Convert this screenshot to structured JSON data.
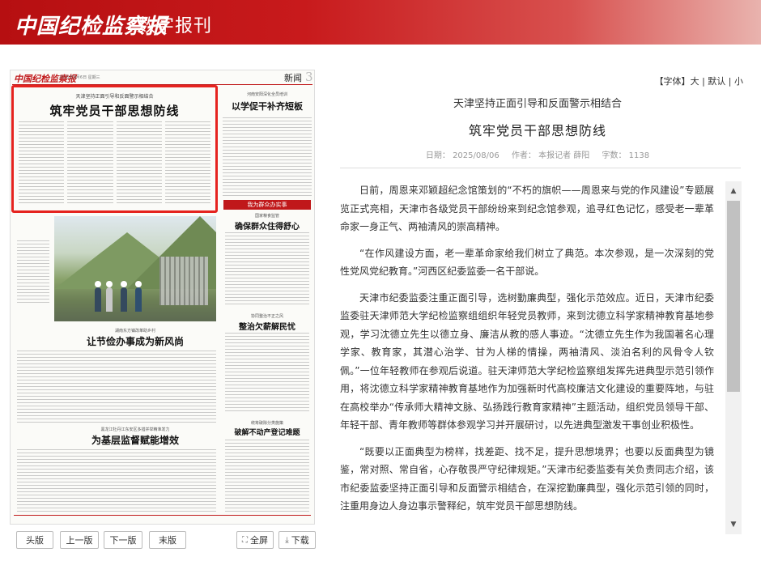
{
  "header": {
    "logo": "中国纪检监察报",
    "subtitle": "数字报刊"
  },
  "paper": {
    "masthead": "中国纪检监察报",
    "date_line": "2025年8月6日 星期三",
    "section": "新闻",
    "page_number": "3",
    "highlight_kicker": "天津坚持正面引导和反面警示相结合",
    "highlight_title": "筑牢党员干部思想防线",
    "right_kicker": "河南安阳深化全员培训",
    "right_title": "以学促干补齐短板",
    "red_bar": "我为群众办实事",
    "sec1_kicker": "国家粮食监管",
    "sec1_title": "确保群众住得舒心",
    "sec2_kicker": "湖南东方镇改革助乡村",
    "sec2_title": "让节俭办事成为新风尚",
    "sec3_kicker": "协同整治不正之风",
    "sec3_title": "整治欠薪解民忧",
    "sec4_kicker": "黑龙江牡丹江东安区多措并举精准发力",
    "sec4_title": "为基层监督赋能增效",
    "sec5_kicker": "统筹破除分类施策",
    "sec5_title": "破解不动产登记难题"
  },
  "font_size": {
    "label": "【字体】",
    "large": "大",
    "default": "默认",
    "small": "小",
    "sep": "|"
  },
  "article": {
    "kicker": "天津坚持正面引导和反面警示相结合",
    "title": "筑牢党员干部思想防线",
    "meta_date": "日期： 2025/08/06",
    "meta_author": "作者： 本报记者 薛阳",
    "meta_words": "字数： 1138",
    "paragraphs": [
      "日前，周恩来邓颖超纪念馆策划的“不朽的旗帜——周恩来与党的作风建设”专题展览正式亮相，天津市各级党员干部纷纷来到纪念馆参观，追寻红色记忆，感受老一辈革命家一身正气、两袖清风的崇高精神。",
      "“在作风建设方面，老一辈革命家给我们树立了典范。本次参观，是一次深刻的党性党风党纪教育。”河西区纪委监委一名干部说。",
      "天津市纪委监委注重正面引导，选树勤廉典型，强化示范效应。近日，天津市纪委监委驻天津师范大学纪检监察组组织年轻党员教师，来到沈德立科学家精神教育基地参观，学习沈德立先生以德立身、廉洁从教的感人事迹。“沈德立先生作为我国著名心理学家、教育家，其潜心治学、甘为人梯的情操，两袖清风、淡泊名利的风骨令人钦佩。”一位年轻教师在参观后说道。驻天津师范大学纪检监察组发挥先进典型示范引领作用，将沈德立科学家精神教育基地作为加强新时代高校廉洁文化建设的重要阵地，与驻在高校举办“传承师大精神文脉、弘扬践行教育家精神”主题活动，组织党员领导干部、年轻干部、青年教师等群体参观学习并开展研讨，以先进典型激发干事创业积极性。",
      "“既要以正面典型为榜样，找差距、找不足，提升思想境界；也要以反面典型为镜鉴，常对照、常自省，心存敬畏严守纪律规矩。”天津市纪委监委有关负责同志介绍，该市纪委监委坚持正面引导和反面警示相结合，在深挖勤廉典型，强化示范引领的同时，注重用身边人身边事示警释纪，筑牢党员干部思想防线。"
    ]
  },
  "scroll": {
    "up": "▲",
    "down": "▼"
  },
  "nav": {
    "first": "头版",
    "prev": "上一版",
    "next": "下一版",
    "last": "末版",
    "fullscreen": "全屏",
    "download": "下载"
  },
  "icons": {
    "fullscreen": "⛶",
    "download": "⤓"
  }
}
